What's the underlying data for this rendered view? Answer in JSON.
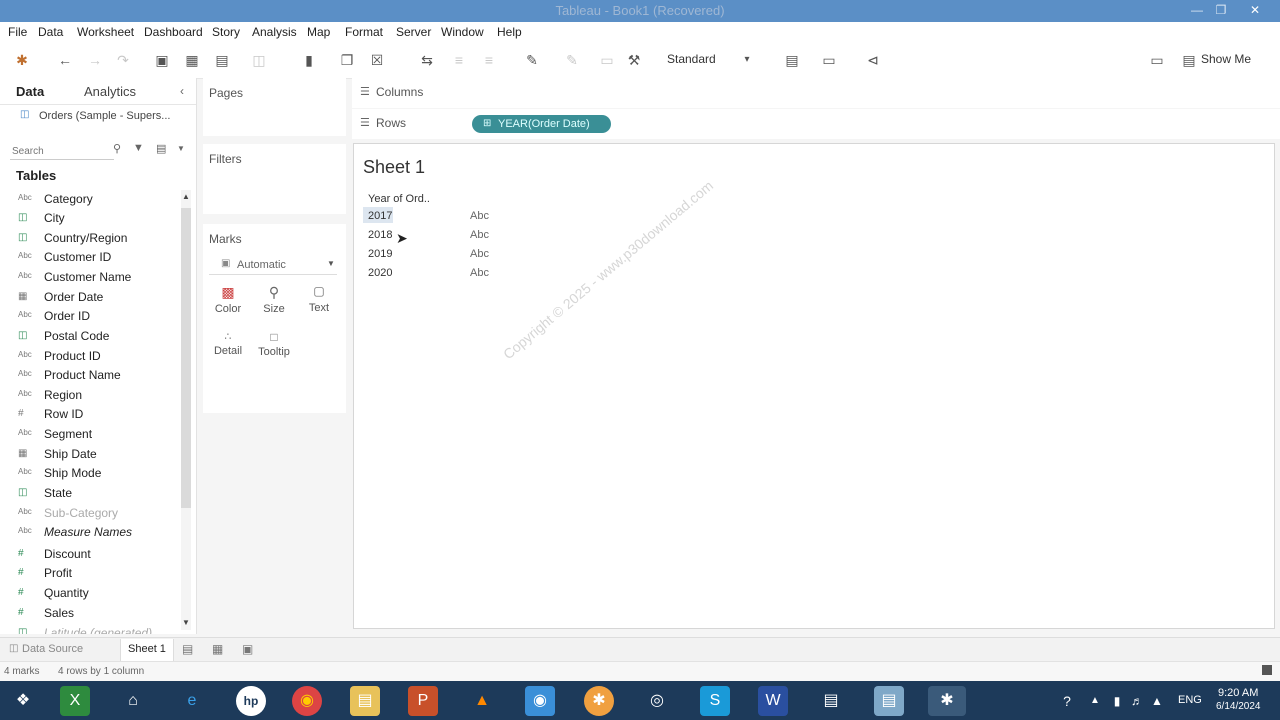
{
  "window": {
    "title": "Tableau - Book1 (Recovered)"
  },
  "menu": [
    "File",
    "Data",
    "Worksheet",
    "Dashboard",
    "Story",
    "Analysis",
    "Map",
    "Format",
    "Server",
    "Window",
    "Help"
  ],
  "toolbar": {
    "fit_label": "Standard",
    "show_me": "Show Me"
  },
  "datapane": {
    "tabs": [
      "Data",
      "Analytics"
    ],
    "datasource": "Orders (Sample - Supers...",
    "search_placeholder": "Search",
    "tables_header": "Tables",
    "fields": [
      {
        "icon": "Abc",
        "name": "Category"
      },
      {
        "icon": "globe",
        "name": "City"
      },
      {
        "icon": "globe",
        "name": "Country/Region"
      },
      {
        "icon": "Abc",
        "name": "Customer ID"
      },
      {
        "icon": "Abc",
        "name": "Customer Name"
      },
      {
        "icon": "calendar",
        "name": "Order Date"
      },
      {
        "icon": "Abc",
        "name": "Order ID"
      },
      {
        "icon": "globe",
        "name": "Postal Code"
      },
      {
        "icon": "Abc",
        "name": "Product ID"
      },
      {
        "icon": "Abc",
        "name": "Product Name"
      },
      {
        "icon": "Abc",
        "name": "Region"
      },
      {
        "icon": "#",
        "name": "Row ID"
      },
      {
        "icon": "Abc",
        "name": "Segment"
      },
      {
        "icon": "calendar",
        "name": "Ship Date"
      },
      {
        "icon": "Abc",
        "name": "Ship Mode"
      },
      {
        "icon": "globe",
        "name": "State"
      },
      {
        "icon": "Abc",
        "name": "Sub-Category"
      },
      {
        "icon": "Abc",
        "name": "Measure Names"
      },
      {
        "icon": "#",
        "name": "Discount"
      },
      {
        "icon": "#",
        "name": "Profit"
      },
      {
        "icon": "#",
        "name": "Quantity"
      },
      {
        "icon": "#",
        "name": "Sales"
      },
      {
        "icon": "globe",
        "name": "Latitude (generated)"
      }
    ]
  },
  "cards": {
    "pages": "Pages",
    "filters": "Filters",
    "marks": "Marks",
    "mark_type": "Automatic",
    "mark_buttons": [
      "Color",
      "Size",
      "Text",
      "Detail",
      "Tooltip"
    ]
  },
  "shelves": {
    "columns": "Columns",
    "rows": "Rows",
    "rows_pill": "YEAR(Order Date)"
  },
  "view": {
    "sheet_title": "Sheet 1",
    "header": "Year of Ord..",
    "rows": [
      {
        "year": "2017",
        "value": "Abc"
      },
      {
        "year": "2018",
        "value": "Abc"
      },
      {
        "year": "2019",
        "value": "Abc"
      },
      {
        "year": "2020",
        "value": "Abc"
      }
    ]
  },
  "tabs": {
    "datasource": "Data Source",
    "sheet": "Sheet 1"
  },
  "status": {
    "marks": "4 marks",
    "dims": "4 rows by 1 column"
  },
  "taskbar": {
    "lang": "ENG",
    "time": "9:20 AM",
    "date": "6/14/2024"
  },
  "watermark": "Copyright © 2025 - www.p30download.com",
  "colors": {
    "titlebar": "#5b8fc6",
    "pill": "#3a8f96",
    "taskbar": "#1d3a5a"
  }
}
